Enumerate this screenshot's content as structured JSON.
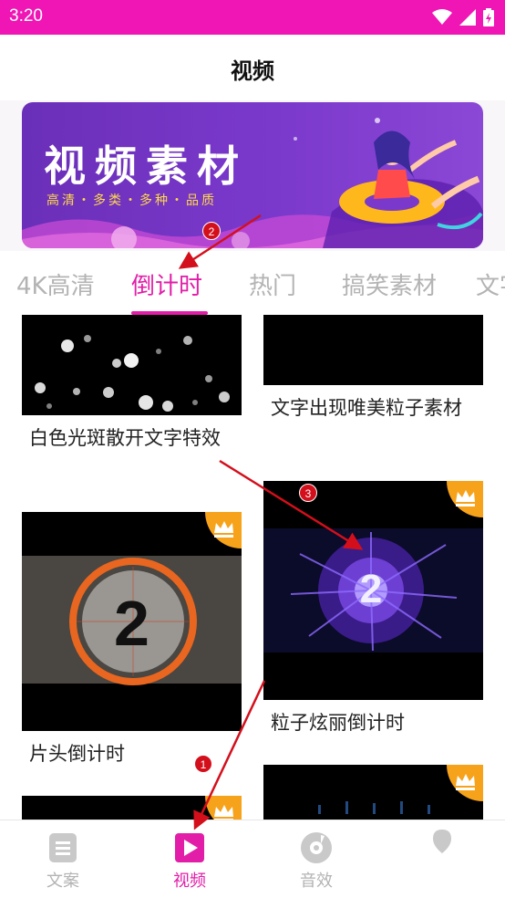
{
  "status_bar": {
    "time": "3:20",
    "icons": [
      "wifi-icon",
      "cell-signal-icon",
      "battery-icon"
    ]
  },
  "header": {
    "title": "视频"
  },
  "banner": {
    "title": "视频素材",
    "subtitle": "高清・多类・多种・品质",
    "illustration": "girl-on-float-illustration"
  },
  "tabs": [
    {
      "label": "4K高清",
      "active": false
    },
    {
      "label": "倒计时",
      "active": true
    },
    {
      "label": "热门",
      "active": false
    },
    {
      "label": "搞笑素材",
      "active": false
    },
    {
      "label": "文字",
      "active": false
    }
  ],
  "videos": [
    {
      "title": "白色光斑散开文字特效",
      "thumb": "white-bokeh-particles",
      "premium": false
    },
    {
      "title": "文字出现唯美粒子素材",
      "thumb": "black-frame",
      "premium": false
    },
    {
      "title": "片头倒计时",
      "thumb": "film-leader-countdown-2",
      "thumb_number": "2",
      "premium": true
    },
    {
      "title": "粒子炫丽倒计时",
      "thumb": "purple-particle-burst-countdown-2",
      "thumb_number": "2",
      "premium": true
    },
    {
      "title": "",
      "thumb": "black-frame",
      "premium": true
    },
    {
      "title": "",
      "thumb": "dark-blue-lights",
      "premium": true
    }
  ],
  "bottom_nav": [
    {
      "label": "文案",
      "icon": "document-icon",
      "active": false
    },
    {
      "label": "视频",
      "icon": "video-play-icon",
      "active": true
    },
    {
      "label": "音效",
      "icon": "music-disc-icon",
      "active": false
    },
    {
      "label": "",
      "icon": "profile-icon",
      "active": false
    }
  ],
  "annotations": [
    {
      "label": "1"
    },
    {
      "label": "2"
    },
    {
      "label": "3"
    }
  ],
  "colors": {
    "accent": "#e21ea8",
    "status_bar": "#ef16b5",
    "crown_badge": "#f7a21b",
    "annotation": "#d40f1c"
  }
}
